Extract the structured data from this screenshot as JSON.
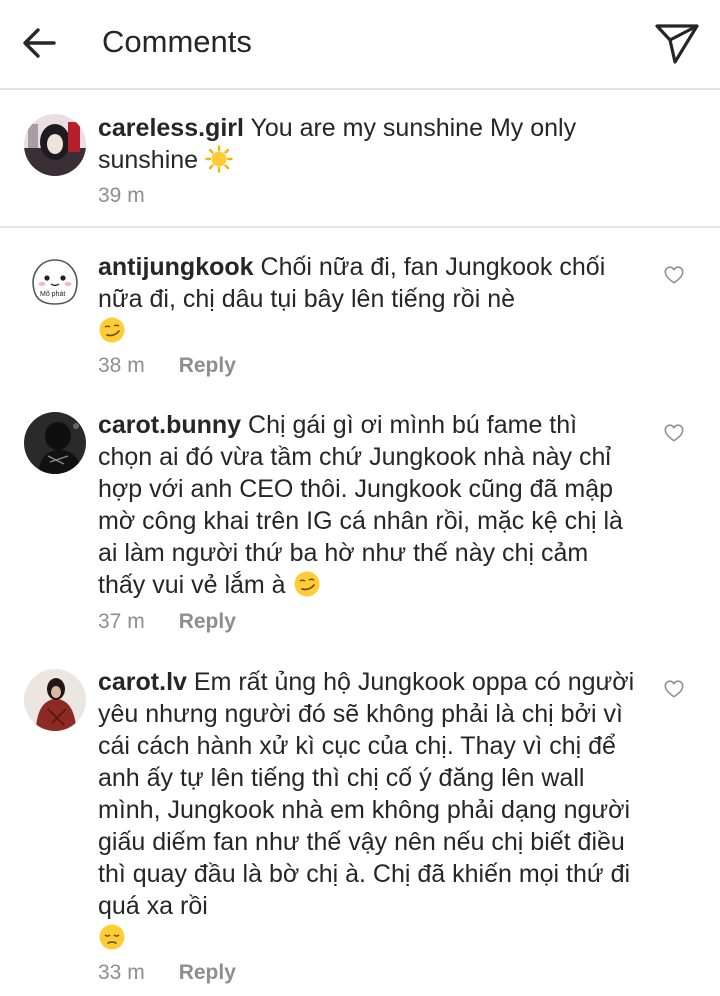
{
  "header": {
    "title": "Comments"
  },
  "caption": {
    "username": "careless.girl",
    "text": "You are my sunshine My only sunshine",
    "emoji": "sun-emoji",
    "time": "39 m"
  },
  "comments": [
    {
      "username": "antijungkook",
      "text": "Chối nữa đi, fan Jungkook chối nữa đi, chị dâu tụi bây lên tiếng rồi nè",
      "emoji": "smirk-emoji",
      "time": "38 m",
      "reply_label": "Reply",
      "avatar_text": "Mõ phát"
    },
    {
      "username": "carot.bunny",
      "text": "Chị gái gì ơi mình bú fame thì chọn ai đó vừa tầm chứ Jungkook nhà này chỉ hợp với anh CEO thôi. Jungkook cũng đã mập mờ công khai trên IG cá nhân rồi, mặc kệ chị là ai làm người thứ ba hờ như thế này chị cảm thấy vui vẻ lắm à",
      "emoji": "smirk-emoji",
      "time": "37 m",
      "reply_label": "Reply"
    },
    {
      "username": "carot.lv",
      "text": "Em rất ủng hộ Jungkook oppa có người yêu nhưng người đó sẽ không phải là chị bởi vì cái cách hành xử kì cục của chị. Thay vì chị để anh ấy tự lên tiếng thì chị cố ý đăng lên wall mình, Jungkook nhà em không phải dạng người giấu diếm fan như thế vậy nên nếu chị biết điều thì quay đầu là bờ chị à. Chị đã khiến mọi thứ đi quá xa rồi",
      "emoji": "pensive-emoji",
      "time": "33 m",
      "reply_label": "Reply"
    }
  ],
  "colors": {
    "text": "#262626",
    "secondary": "#8e8e8e",
    "divider": "#e3e3e3",
    "emoji_yellow": "#ffcc33"
  }
}
